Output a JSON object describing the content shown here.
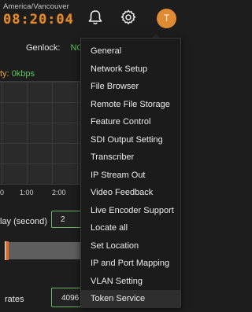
{
  "header": {
    "timezone": "America/Vancouver",
    "clock": "08:20:04",
    "avatar_initial": "T"
  },
  "status": {
    "genlock_label": "Genlock:",
    "genlock_value": "NO",
    "bitrate_label": "ty:",
    "bitrate_value": "0kbps"
  },
  "graph": {
    "ticks": [
      "0",
      "1:00",
      "2:00"
    ]
  },
  "delay": {
    "label": "lay (second)",
    "value": "2"
  },
  "rates": {
    "label": "rates",
    "value": "4096"
  },
  "menu": {
    "items": [
      "General",
      "Network Setup",
      "File Browser",
      "Remote File Storage",
      "Feature Control",
      "SDI Output Setting",
      "Transcriber",
      "IP Stream Out",
      "Video Feedback",
      "Live Encoder Support",
      "Locate all",
      "Set Location",
      "IP and Port Mapping",
      "VLAN Setting",
      "Token Service"
    ]
  },
  "colors": {
    "accent": "#e08a33",
    "ok": "#5ac25a"
  }
}
